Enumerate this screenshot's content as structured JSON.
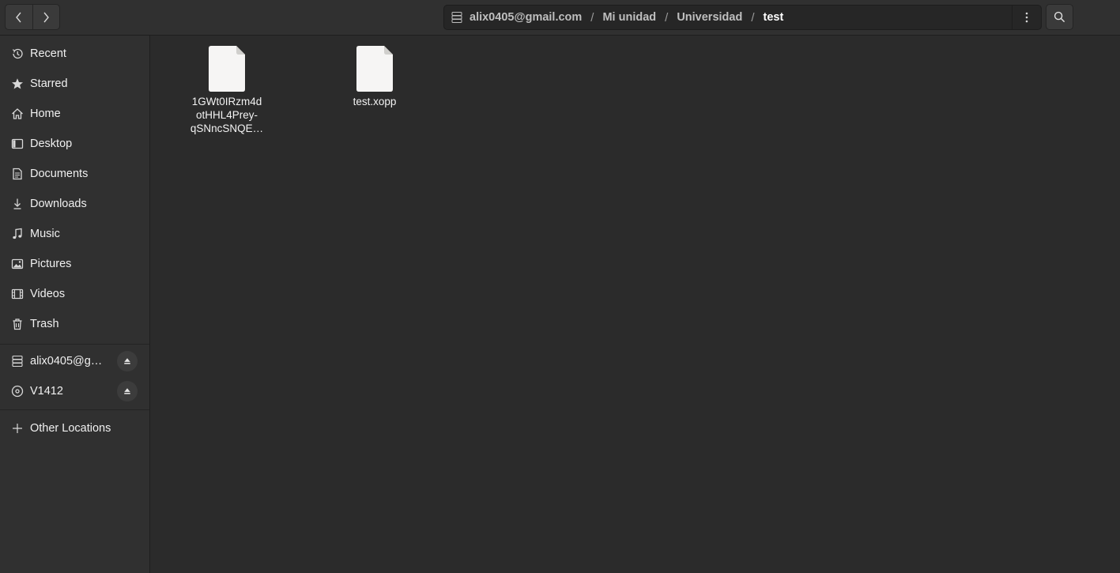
{
  "header": {
    "path": {
      "crumbs": [
        "alix0405@gmail.com",
        "Mi unidad",
        "Universidad",
        "test"
      ],
      "separator": "/"
    }
  },
  "sidebar": {
    "places": [
      {
        "label": "Recent",
        "icon": "clock-icon"
      },
      {
        "label": "Starred",
        "icon": "star-icon"
      },
      {
        "label": "Home",
        "icon": "home-icon"
      },
      {
        "label": "Desktop",
        "icon": "desktop-icon"
      },
      {
        "label": "Documents",
        "icon": "document-icon"
      },
      {
        "label": "Downloads",
        "icon": "download-icon"
      },
      {
        "label": "Music",
        "icon": "music-icon"
      },
      {
        "label": "Pictures",
        "icon": "picture-icon"
      },
      {
        "label": "Videos",
        "icon": "video-icon"
      },
      {
        "label": "Trash",
        "icon": "trash-icon"
      }
    ],
    "mounts": [
      {
        "label": "alix0405@g…",
        "icon": "network-drive-icon"
      },
      {
        "label": "V1412",
        "icon": "optical-disc-icon"
      }
    ],
    "other": {
      "label": "Other Locations",
      "icon": "plus-icon"
    }
  },
  "files": [
    {
      "name": "1GWt0IRzm4dotHHL4Prey-qSNncSNQE…",
      "lines": [
        "1GWt0IRzm4d",
        "otHHL4Prey-",
        "qSNncSNQE…"
      ],
      "icon": "file-icon"
    },
    {
      "name": "test.xopp",
      "lines": [
        "test.xopp"
      ],
      "icon": "file-icon"
    }
  ]
}
